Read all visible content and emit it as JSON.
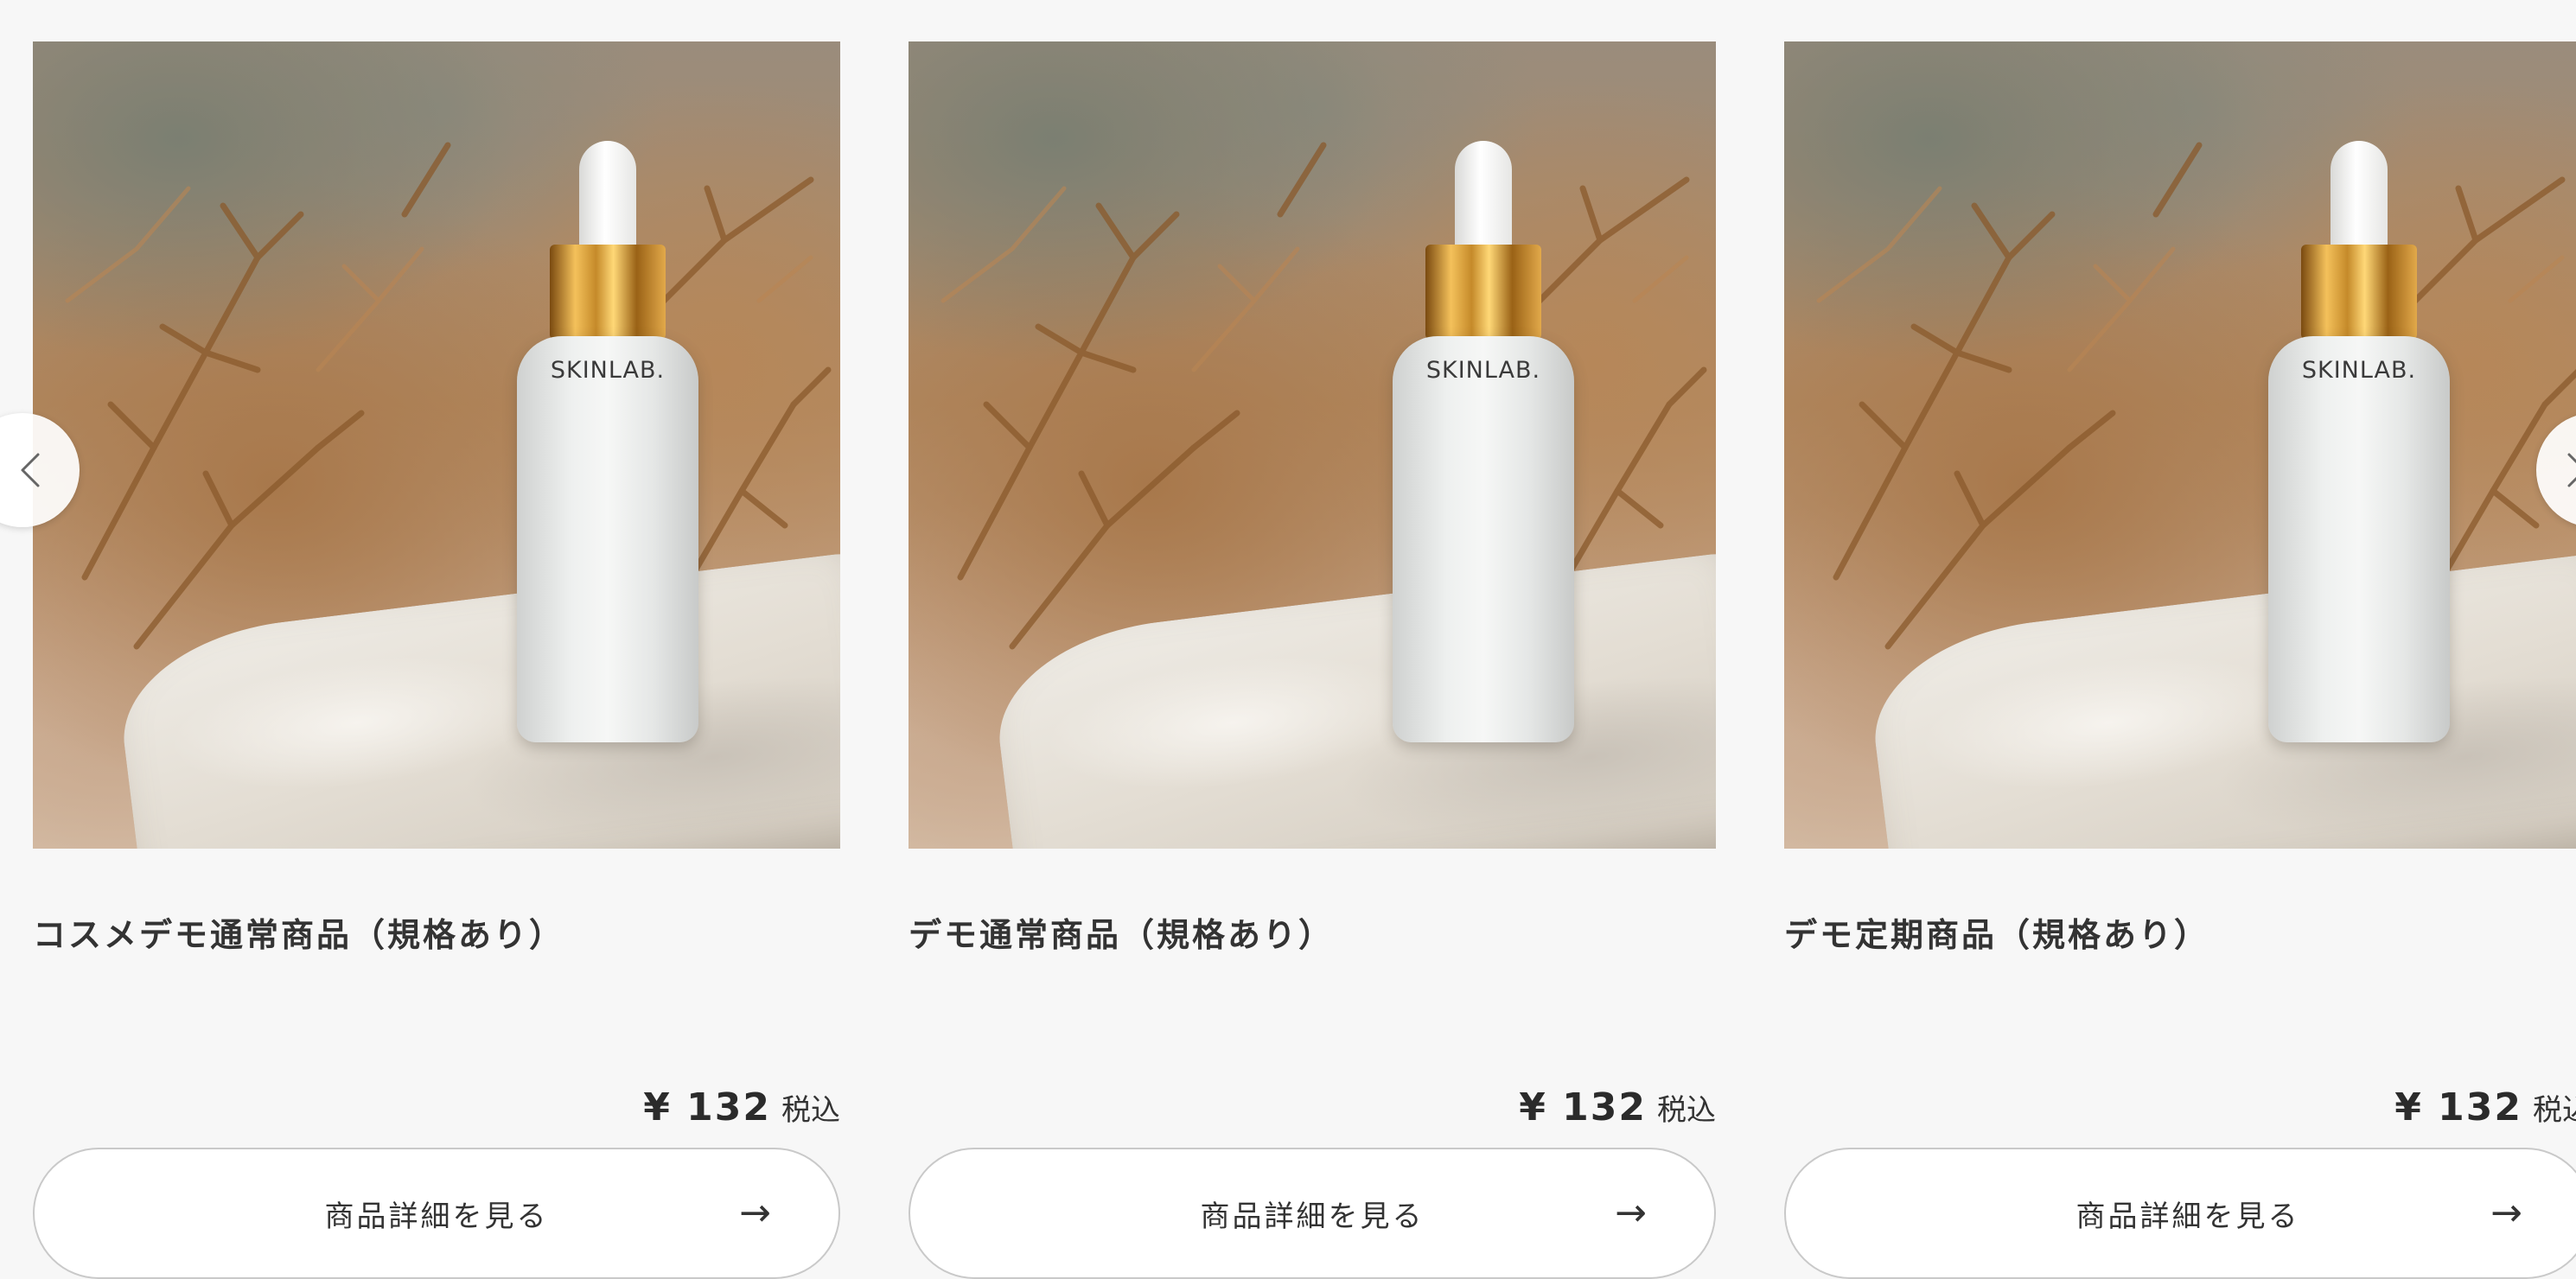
{
  "products": [
    {
      "title": "コスメデモ通常商品（規格あり）",
      "bottle_label": "SKINLAB.",
      "price": "¥ 132",
      "tax_label": "税込",
      "button_label": "商品詳細を見る",
      "button_icon": "arrow-right-icon"
    },
    {
      "title": "デモ通常商品（規格あり）",
      "bottle_label": "SKINLAB.",
      "price": "¥ 132",
      "tax_label": "税込",
      "button_label": "商品詳細を見る",
      "button_icon": "arrow-right-icon"
    },
    {
      "title": "デモ定期商品（規格あり）",
      "bottle_label": "SKINLAB.",
      "price": "¥ 132",
      "tax_label": "税込",
      "button_label": "商品詳細を見る",
      "button_icon": "arrow-right-icon"
    }
  ],
  "carousel": {
    "prev_icon": "chevron-left-icon",
    "next_icon": "chevron-right-icon"
  },
  "colors": {
    "background": "#f7f7f7",
    "text": "#2b2b2b",
    "button_border": "#c9c9c9",
    "cap_gold": "#c58a2a"
  }
}
